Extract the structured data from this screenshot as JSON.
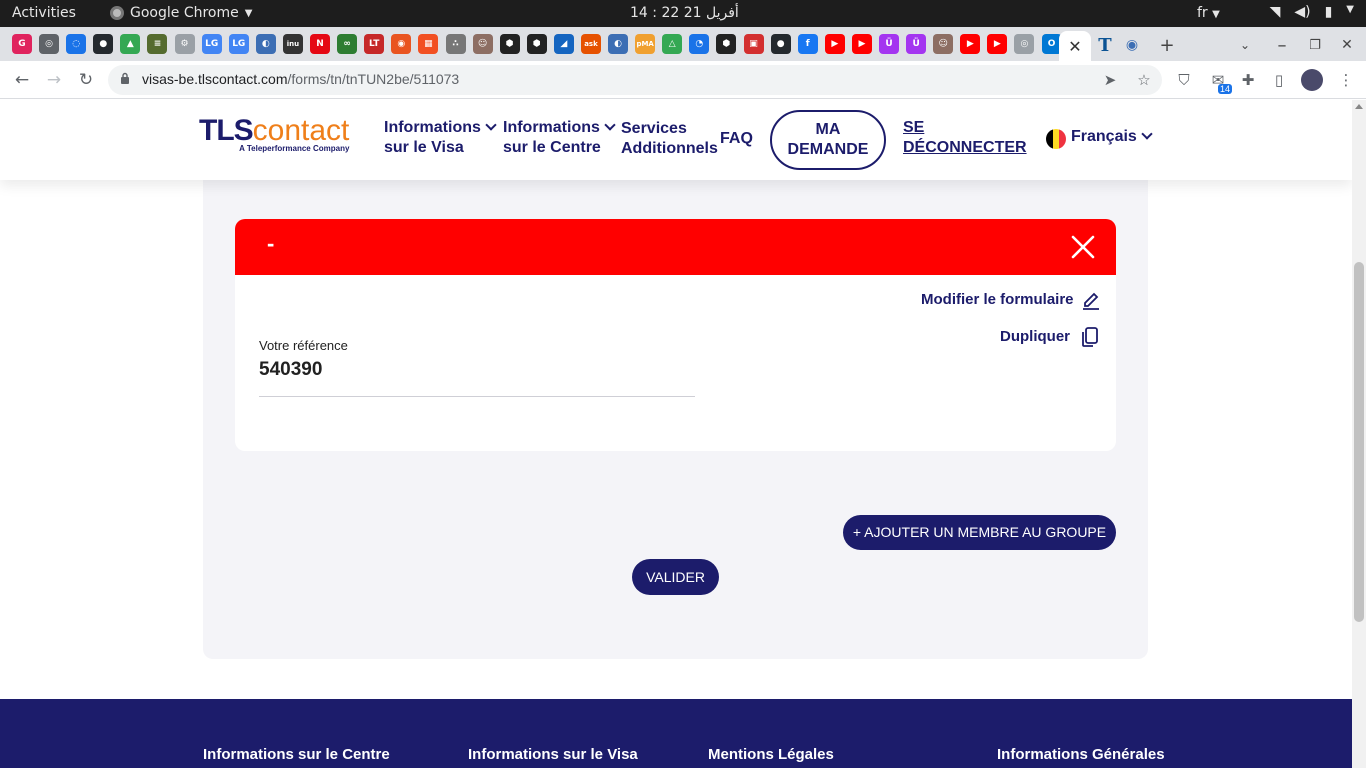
{
  "system_bar": {
    "activities": "Activities",
    "app_name": "Google Chrome",
    "clock": "أفريل 21  22 : 14",
    "input_lang": "fr"
  },
  "browser": {
    "url_host": "visas-be.tlscontact.com",
    "url_path": "/forms/tn/tnTUN2be/511073",
    "extension_badge": "14",
    "tab_icons": [
      {
        "name": "tab-favicon-1",
        "color": "#e0245e",
        "glyph": "G"
      },
      {
        "name": "tab-favicon-2",
        "color": "#5f6368",
        "glyph": "◎"
      },
      {
        "name": "tab-favicon-3",
        "color": "#1a73e8",
        "glyph": "◌"
      },
      {
        "name": "tab-favicon-github",
        "color": "#24292e",
        "glyph": "●"
      },
      {
        "name": "tab-favicon-drive",
        "color": "#34a853",
        "glyph": "▲"
      },
      {
        "name": "tab-favicon-6",
        "color": "#556b2f",
        "glyph": "≡"
      },
      {
        "name": "tab-favicon-7",
        "color": "#9aa0a6",
        "glyph": "⚙"
      },
      {
        "name": "tab-favicon-lg1",
        "color": "#4285f4",
        "glyph": "LG"
      },
      {
        "name": "tab-favicon-lg2",
        "color": "#4285f4",
        "glyph": "LG"
      },
      {
        "name": "tab-favicon-10",
        "color": "#3c6eb4",
        "glyph": "◐"
      },
      {
        "name": "tab-favicon-inu",
        "color": "#333333",
        "glyph": "inu"
      },
      {
        "name": "tab-favicon-netflix",
        "color": "#e50914",
        "glyph": "N"
      },
      {
        "name": "tab-favicon-13",
        "color": "#2e7d32",
        "glyph": "∞"
      },
      {
        "name": "tab-favicon-lt",
        "color": "#c62828",
        "glyph": "LT"
      },
      {
        "name": "tab-favicon-ubuntu",
        "color": "#e95420",
        "glyph": "◉"
      },
      {
        "name": "tab-favicon-ms",
        "color": "#f25022",
        "glyph": "▦"
      },
      {
        "name": "tab-favicon-17",
        "color": "#777777",
        "glyph": "∴"
      },
      {
        "name": "tab-favicon-18",
        "color": "#8d6e63",
        "glyph": "☺"
      },
      {
        "name": "tab-favicon-19",
        "color": "#222222",
        "glyph": "⬢"
      },
      {
        "name": "tab-favicon-20",
        "color": "#222222",
        "glyph": "⬢"
      },
      {
        "name": "tab-favicon-21",
        "color": "#1565c0",
        "glyph": "◢"
      },
      {
        "name": "tab-favicon-ask",
        "color": "#e65100",
        "glyph": "ask"
      },
      {
        "name": "tab-favicon-23",
        "color": "#3c6eb4",
        "glyph": "◐"
      },
      {
        "name": "tab-favicon-pma",
        "color": "#f0a030",
        "glyph": "pMA"
      },
      {
        "name": "tab-favicon-25",
        "color": "#34a853",
        "glyph": "△"
      },
      {
        "name": "tab-favicon-26",
        "color": "#1a73e8",
        "glyph": "◔"
      },
      {
        "name": "tab-favicon-27",
        "color": "#222222",
        "glyph": "⬢"
      },
      {
        "name": "tab-favicon-28",
        "color": "#d32f2f",
        "glyph": "▣"
      },
      {
        "name": "tab-favicon-github2",
        "color": "#24292e",
        "glyph": "●"
      },
      {
        "name": "tab-favicon-facebook",
        "color": "#1877f2",
        "glyph": "f"
      },
      {
        "name": "tab-favicon-youtube1",
        "color": "#ff0000",
        "glyph": "▶"
      },
      {
        "name": "tab-favicon-youtube2",
        "color": "#ff0000",
        "glyph": "▶"
      },
      {
        "name": "tab-favicon-udemy1",
        "color": "#a435f0",
        "glyph": "Ü"
      },
      {
        "name": "tab-favicon-udemy2",
        "color": "#a435f0",
        "glyph": "Ü"
      },
      {
        "name": "tab-favicon-35",
        "color": "#8d6e63",
        "glyph": "☺"
      },
      {
        "name": "tab-favicon-youtube3",
        "color": "#ff0000",
        "glyph": "▶"
      },
      {
        "name": "tab-favicon-youtube4",
        "color": "#ff0000",
        "glyph": "▶"
      },
      {
        "name": "tab-favicon-38",
        "color": "#9aa0a6",
        "glyph": "◎"
      },
      {
        "name": "tab-favicon-outlook",
        "color": "#0078d4",
        "glyph": "O"
      }
    ]
  },
  "header": {
    "logo_tls": "TLS",
    "logo_contact": "contact",
    "logo_tagline": "A Teleperformance Company",
    "nav": {
      "visa_info_1": "Informations",
      "visa_info_2": "sur le Visa",
      "centre_info_1": "Informations",
      "centre_info_2": "sur le Centre",
      "services_1": "Services",
      "services_2": "Additionnels",
      "faq": "FAQ"
    },
    "ma_demande_1": "MA",
    "ma_demande_2": "DEMANDE",
    "deconnect_1": "SE",
    "deconnect_2": "DÉCONNECTER",
    "language": "Français"
  },
  "card": {
    "title": "-",
    "edit_label": "Modifier le formulaire",
    "duplicate_label": "Dupliquer",
    "reference_label": "Votre référence",
    "reference_value": "540390"
  },
  "buttons": {
    "add_member": "+ AJOUTER UN MEMBRE AU GROUPE",
    "validate": "VALIDER"
  },
  "footer": {
    "col1": "Informations sur le Centre",
    "col2": "Informations sur le Visa",
    "col3": "Mentions Légales",
    "col4": "Informations Générales"
  },
  "colors": {
    "brand_navy": "#1c1c6b",
    "brand_orange": "#ef7f1a",
    "alert_red": "#ff0000"
  }
}
